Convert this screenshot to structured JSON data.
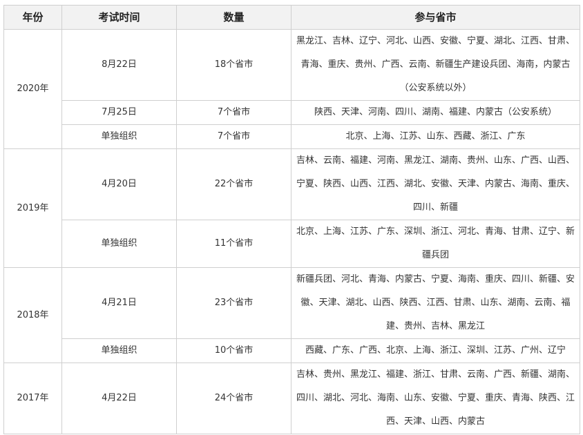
{
  "headers": [
    "年份",
    "考试时间",
    "数量",
    "参与省市"
  ],
  "rows": [
    {
      "year": "2020年",
      "sub": [
        {
          "date": "8月22日",
          "count": "18个省市",
          "provinces": "黑龙江、吉林、辽宁、河北、山西、安徽、宁夏、湖北、江西、甘肃、青海、重庆、贵州、广西、云南、新疆生产建设兵团、海南，内蒙古（公安系统以外）"
        },
        {
          "date": "7月25日",
          "count": "7个省市",
          "provinces": "陕西、天津、河南、四川、湖南、福建、内蒙古（公安系统）"
        },
        {
          "date": "单独组织",
          "count": "7个省市",
          "provinces": "北京、上海、江苏、山东、西藏、浙江、广东"
        }
      ]
    },
    {
      "year": "2019年",
      "sub": [
        {
          "date": "4月20日",
          "count": "22个省市",
          "provinces": "吉林、云南、福建、河南、黑龙江、湖南、贵州、山东、广西、山西、宁夏、陕西、山西、江西、湖北、安徽、天津、内蒙古、海南、重庆、四川、新疆"
        },
        {
          "date": "单独组织",
          "count": "11个省市",
          "provinces": "北京、上海、江苏、广东、深圳、浙江、河北、青海、甘肃、辽宁、新疆兵团"
        }
      ]
    },
    {
      "year": "2018年",
      "sub": [
        {
          "date": "4月21日",
          "count": "23个省市",
          "provinces": "新疆兵团、河北、青海、内蒙古、宁夏、海南、重庆、四川、新疆、安徽、天津、湖北、山西、陕西、江西、甘肃、山东、湖南、云南、福建、贵州、吉林、黑龙江"
        },
        {
          "date": "单独组织",
          "count": "10个省市",
          "provinces": "西藏、广东、广西、北京、上海、浙江、深圳、江苏、广州、辽宁"
        }
      ]
    },
    {
      "year": "2017年",
      "sub": [
        {
          "date": "4月22日",
          "count": "24个省市",
          "provinces": "吉林、贵州、黑龙江、福建、浙江、甘肃、云南、广西、新疆、湖南、四川、湖北、河北、海南、山东、安徽、宁夏、重庆、青海、陕西、江西、天津、山西、内蒙古"
        }
      ]
    }
  ]
}
